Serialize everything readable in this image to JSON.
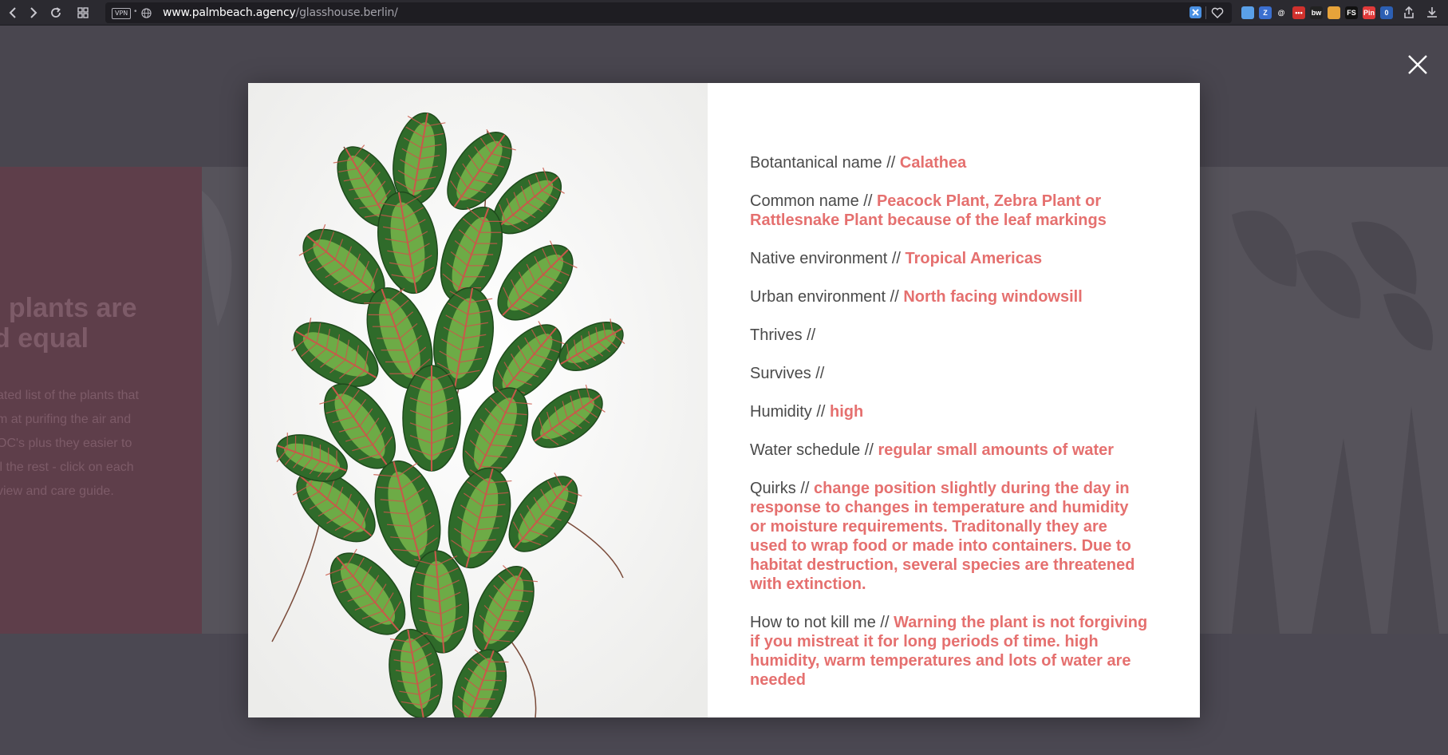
{
  "browser": {
    "vpn_label": "VPN",
    "url_domain": "www.palmbeach.agency",
    "url_path": "/glasshouse.berlin/",
    "extensions": [
      {
        "icon": "photos-icon",
        "glyph": "",
        "color": "#5aa0e8"
      },
      {
        "icon": "zotero-icon",
        "glyph": "Z",
        "color": "#3b6fcf"
      },
      {
        "icon": "at-icon",
        "glyph": "@",
        "color": "#2b2a30"
      },
      {
        "icon": "lastpass-icon",
        "glyph": "•••",
        "color": "#d0312d"
      },
      {
        "icon": "bw-icon",
        "glyph": "bw",
        "color": "#222222"
      },
      {
        "icon": "cookie-icon",
        "glyph": "",
        "color": "#e7a33a"
      },
      {
        "icon": "fs-icon",
        "glyph": "FS",
        "color": "#111111"
      },
      {
        "icon": "pinterest-icon",
        "glyph": "Pin",
        "color": "#e13a3a"
      },
      {
        "icon": "counter-icon",
        "glyph": "0",
        "color": "#2c5fb3"
      }
    ]
  },
  "background": {
    "heading": "l plants are\nd equal",
    "paragraph": "ated list of the plants that\nm at purifing the air and\nOC's plus they easier to\nll the rest - click on each\nview and care guide."
  },
  "modal": {
    "rows": [
      {
        "label": "Botantanical name // ",
        "value": "Calathea"
      },
      {
        "label": "Common name //  ",
        "value": "Peacock Plant, Zebra Plant or Rattlesnake Plant because of the leaf markings"
      },
      {
        "label": "Native environment //  ",
        "value": "Tropical Americas"
      },
      {
        "label": "Urban environment // ",
        "value": "North facing windowsill"
      },
      {
        "label": "Thrives // ",
        "value": ""
      },
      {
        "label": "Survives // ",
        "value": ""
      },
      {
        "label": "Humidity // ",
        "value": "high"
      },
      {
        "label": "Water schedule // ",
        "value": "regular small amounts of water"
      },
      {
        "label": "Quirks // ",
        "value": "change position slightly during the day in response to changes in temperature and humidity or moisture requirements. Traditonally they are used to wrap food or made into containers.  Due to habitat destruction, several species are threatened with extinction."
      },
      {
        "label": "How to not kill me // ",
        "value": "Warning the plant is not forgiving if you mistreat it for long periods of time. high humidity, warm temperatures and lots of water are needed"
      }
    ]
  }
}
